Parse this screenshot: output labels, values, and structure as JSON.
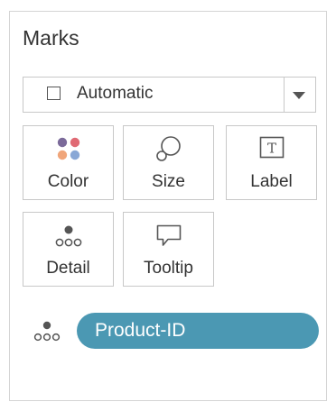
{
  "marks": {
    "title": "Marks",
    "mark_type": {
      "selected": "Automatic",
      "icon": "checkbox-icon"
    },
    "cards": [
      {
        "label": "Color",
        "icon": "color-palette-icon"
      },
      {
        "label": "Size",
        "icon": "size-icon"
      },
      {
        "label": "Label",
        "icon": "label-icon"
      },
      {
        "label": "Detail",
        "icon": "detail-icon"
      },
      {
        "label": "Tooltip",
        "icon": "tooltip-icon"
      }
    ],
    "fields": [
      {
        "name": "Product-ID",
        "encoding_icon": "detail-icon",
        "color": "#4b98b3"
      }
    ]
  }
}
